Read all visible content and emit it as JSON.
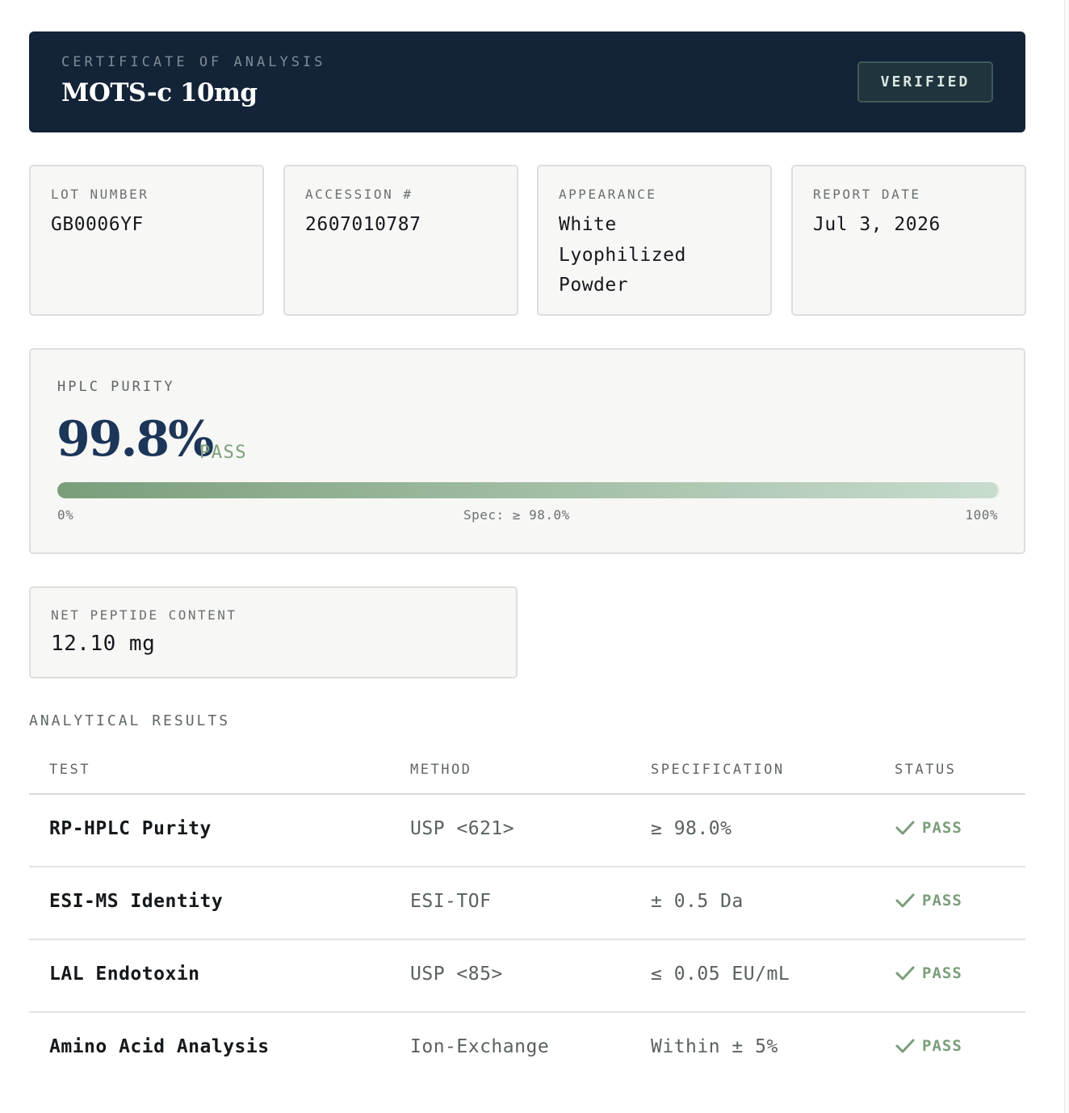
{
  "header": {
    "kicker": "CERTIFICATE OF ANALYSIS",
    "title": "MOTS-c 10mg",
    "badge": "VERIFIED"
  },
  "info_cards": [
    {
      "label": "LOT NUMBER",
      "value": "GB0006YF"
    },
    {
      "label": "ACCESSION #",
      "value": "2607010787"
    },
    {
      "label": "APPEARANCE",
      "value": "White Lyophilized Powder"
    },
    {
      "label": "REPORT DATE",
      "value": "Jul 3, 2026"
    }
  ],
  "purity": {
    "label": "HPLC PURITY",
    "value": "99.8%",
    "status": "PASS",
    "fraction": 0.998,
    "scale_min": "0%",
    "spec": "Spec: ≥ 98.0%",
    "scale_max": "100%"
  },
  "net_peptide": {
    "label": "NET PEPTIDE CONTENT",
    "value": "12.10 mg"
  },
  "results": {
    "title": "ANALYTICAL RESULTS",
    "columns": [
      "TEST",
      "METHOD",
      "SPECIFICATION",
      "STATUS"
    ],
    "rows": [
      {
        "test": "RP-HPLC Purity",
        "method": "USP <621>",
        "spec": "≥ 98.0%",
        "status": "PASS"
      },
      {
        "test": "ESI-MS Identity",
        "method": "ESI-TOF",
        "spec": "± 0.5 Da",
        "status": "PASS"
      },
      {
        "test": "LAL Endotoxin",
        "method": "USP <85>",
        "spec": "≤ 0.05 EU/mL",
        "status": "PASS"
      },
      {
        "test": "Amino Acid Analysis",
        "method": "Ion-Exchange",
        "spec": "Within ± 5%",
        "status": "PASS"
      }
    ]
  },
  "colors": {
    "header_bg": "#132338",
    "pass_green": "#7a9e7a",
    "purity_navy": "#1c3558"
  },
  "icons": {
    "status": "check-icon"
  }
}
